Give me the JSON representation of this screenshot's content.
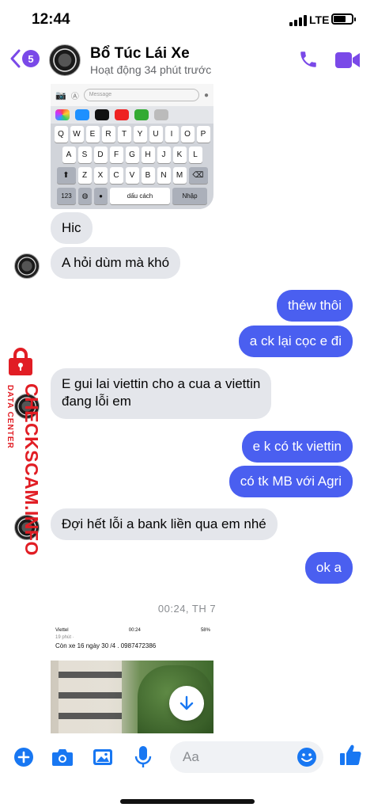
{
  "status_bar": {
    "time": "12:44",
    "network": "LTE"
  },
  "header": {
    "back_count": "5",
    "contact_name": "Bổ Túc Lái Xe",
    "activity": "Hoạt động 34 phút trước"
  },
  "keyboard_image": {
    "message_placeholder": "Message",
    "rows": [
      [
        "Q",
        "W",
        "E",
        "R",
        "T",
        "Y",
        "U",
        "I",
        "O",
        "P"
      ],
      [
        "A",
        "S",
        "D",
        "F",
        "G",
        "H",
        "J",
        "K",
        "L"
      ],
      [
        "Z",
        "X",
        "C",
        "V",
        "B",
        "N",
        "M"
      ]
    ],
    "key_123": "123",
    "space_label": "dấu cách",
    "enter_label": "Nhập"
  },
  "messages": [
    {
      "from": "them",
      "text": "Hic"
    },
    {
      "from": "them",
      "text": "A hỏi dùm mà khó"
    },
    {
      "from": "me",
      "text": "théw thôi"
    },
    {
      "from": "me",
      "text": "a ck lại cọc e đi"
    },
    {
      "from": "them",
      "text": "E gui lai viettin cho a cua a viettin"
    },
    {
      "from": "them",
      "text": "đang lỗi em"
    },
    {
      "from": "me",
      "text": "e k có tk viettin"
    },
    {
      "from": "me",
      "text": "có tk MB với Agri"
    },
    {
      "from": "them",
      "text": "Đợi hết lỗi a bank liền qua em nhé"
    },
    {
      "from": "me",
      "text": "ok a"
    }
  ],
  "divider_time": "00:24, TH 7",
  "shared_image": {
    "carrier": "Viettel",
    "time": "00:24",
    "battery": "58%",
    "subtitle": "19 phút ·",
    "caption": "Còn xe 16 ngày 30 /4 . 0987472386"
  },
  "composer": {
    "placeholder": "Aa"
  },
  "watermark": {
    "brand": "CHECKSCAM.INFO",
    "tag": "DATA CENTER"
  },
  "colors": {
    "accent": "#7a49e8",
    "outgoing": "#4a5ff0",
    "incoming": "#e4e6eb",
    "composer_icons": "#1877f2"
  }
}
